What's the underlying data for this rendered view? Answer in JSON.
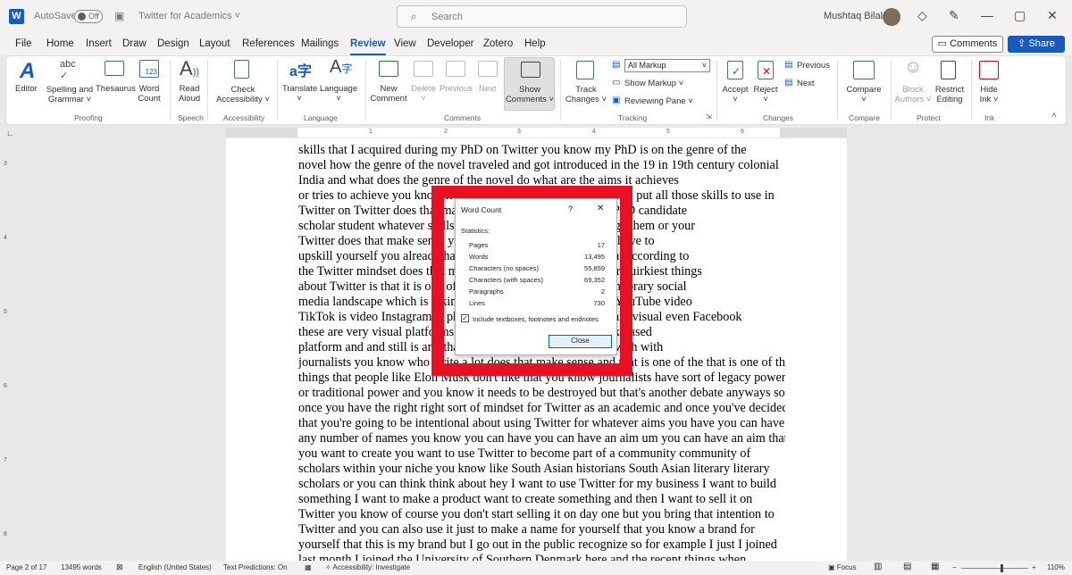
{
  "titlebar": {
    "autosave_label": "AutoSave",
    "autosave_state": "Off",
    "doc_title": "Twitter for Academics",
    "search_placeholder": "Search",
    "user_name": "Mushtaq Bilal"
  },
  "menu": {
    "items": [
      "File",
      "Home",
      "Insert",
      "Draw",
      "Design",
      "Layout",
      "References",
      "Mailings",
      "Review",
      "View",
      "Developer",
      "Zotero",
      "Help"
    ],
    "active": "Review",
    "comments_btn": "Comments",
    "share_btn": "Share"
  },
  "ribbon": {
    "editor": "Editor",
    "spelling": "Spelling and",
    "spelling2": "Grammar ˅",
    "thesaurus": "Thesaurus",
    "word_count": "Word",
    "word_count2": "Count",
    "read_aloud": "Read",
    "read_aloud2": "Aloud",
    "check_access": "Check",
    "check_access2": "Accessibility ˅",
    "translate": "Translate",
    "language": "Language",
    "new_comment": "New",
    "new_comment2": "Comment",
    "delete": "Delete",
    "previous": "Previous",
    "next": "Next",
    "show_comments": "Show",
    "show_comments2": "Comments ˅",
    "track_changes": "Track",
    "track_changes2": "Changes ˅",
    "all_markup": "All Markup",
    "show_markup": "Show Markup ˅",
    "reviewing_pane": "Reviewing Pane ˅",
    "accept": "Accept",
    "reject": "Reject",
    "prev_change": "Previous",
    "next_change": "Next",
    "compare": "Compare",
    "block_authors": "Block",
    "block_authors2": "Authors ˅",
    "restrict_editing": "Restrict",
    "restrict_editing2": "Editing",
    "hide_ink": "Hide",
    "hide_ink2": "Ink ˅",
    "groups": [
      "Proofing",
      "Speech",
      "Accessibility",
      "Language",
      "Comments",
      "Tracking",
      "Changes",
      "Compare",
      "Protect",
      "Ink"
    ],
    "abc": "abc",
    "abc123": "123"
  },
  "ruler": {
    "numbers": [
      "1",
      "2",
      "3",
      "4",
      "5",
      "6"
    ],
    "vnumbers": [
      "3",
      "4",
      "5",
      "6",
      "7",
      "8"
    ]
  },
  "document": {
    "lines": [
      "skills that I acquired during my PhD on Twitter you know my PhD is on the genre of the",
      "novel how the genre of the novel traveled and got introduced in the 19 in 19th century colonial",
      "India and what does the genre of the novel do what are the aims it achieves",
      "or tries to achieve you know it's aspirations and it's objectives so I put all those skills to use in",
      "Twitter on Twitter does that make sense so what if you are up PhD candidate",
      "scholar student whatever skills you have you are able to package them or your",
      "Twitter does that make sense you you don't you skill you don't have to",
      "upskill yourself you already have the skills have to package that according to",
      "the Twitter mindset does that make sense the quirkiest things or quirkiest things",
      "about Twitter is that it is one of the most verbal word in contemporary social",
      "media landscape which is taking over by visual platforms like YouTube video",
      "TikTok is video Instagram is photographic all these platforms are visual even Facebook",
      "these are very visual platforms and Twitter the reason was a tax based",
      "platform and and still is and that is one thing that it is it wipes with with",
      "journalists you know who write a lot does that make sense and that is one of the that is one of the",
      "things that people like Elon Musk don't like that you know journalists have sort of legacy power",
      "or traditional power and you know it needs to be destroyed but that's another debate anyways so",
      "once you have the right right sort of mindset for Twitter as an academic and once you've decided",
      "that you're going to be intentional about using Twitter for whatever aims you have you can have",
      "any number of names you know you can have you can have an aim um you can have an aim that",
      "you want to create you want to use Twitter to become part of a community community of",
      "scholars within your niche you know like South Asian historians South Asian literary literary",
      "scholars or you can think think about hey I want to use Twitter for my business I want to build",
      "something I want to make a product want to create something and then I want to sell it on",
      "Twitter you know of course you don't start selling it on day one but you bring that intention to",
      "Twitter and you can also use it just to make a name for yourself that you know a brand for",
      "yourself that this is my brand but I go out in the public recognize so for example I just I joined",
      "last month I joined the University of Southern Denmark here and the recent things when"
    ]
  },
  "dialog": {
    "title": "Word Count",
    "help": "?",
    "close_x": "✕",
    "section": "Statistics:",
    "stats": [
      {
        "label": "Pages",
        "value": "17"
      },
      {
        "label": "Words",
        "value": "13,495"
      },
      {
        "label": "Characters (no spaces)",
        "value": "55,859"
      },
      {
        "label": "Characters (with spaces)",
        "value": "69,352"
      },
      {
        "label": "Paragraphs",
        "value": "2"
      },
      {
        "label": "Lines",
        "value": "730"
      }
    ],
    "checkbox_label": "Include textboxes, footnotes and endnotes",
    "checkbox_checked": "✓",
    "close_button": "Close"
  },
  "status": {
    "page": "Page 2 of 17",
    "words": "13495 words",
    "language": "English (United States)",
    "predictions": "Text Predictions: On",
    "accessibility": "Accessibility: Investigate",
    "focus": "Focus",
    "zoom": "110%"
  },
  "colors": {
    "accent": "#185abd",
    "highlight": "#e81123"
  }
}
